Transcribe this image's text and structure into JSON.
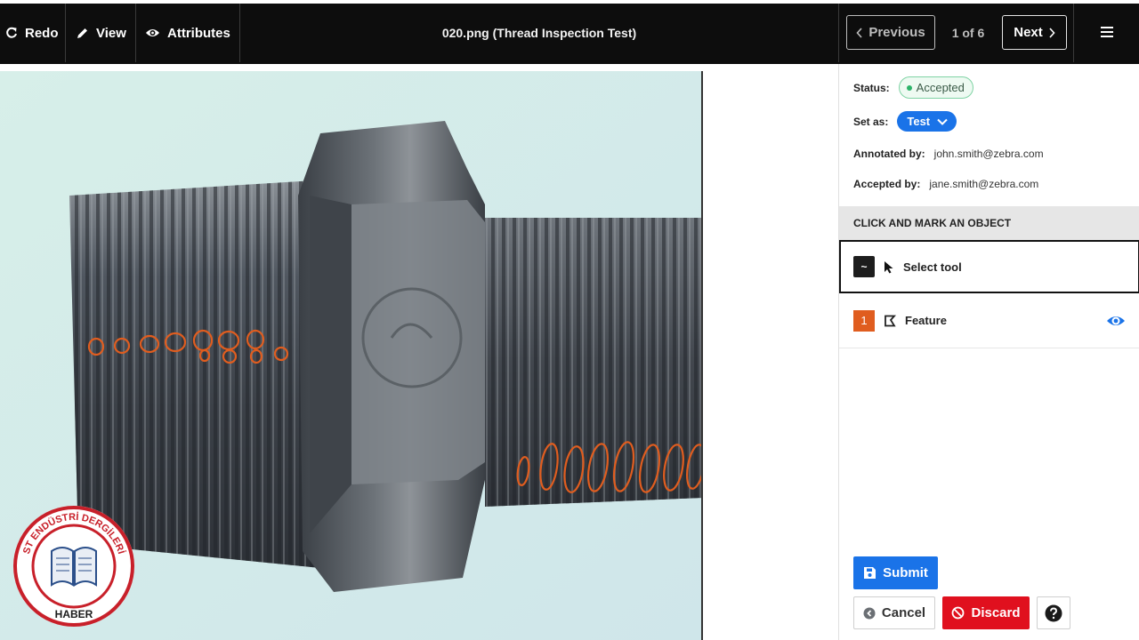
{
  "toolbar": {
    "redo_label": "Redo",
    "view_label": "View",
    "attributes_label": "Attributes",
    "title": "020.png (Thread Inspection Test)",
    "previous_label": "Previous",
    "counter": "1 of 6",
    "next_label": "Next",
    "icons": {
      "redo": "redo-icon",
      "view": "pencil-icon",
      "attributes": "eye-icon",
      "menu": "hamburger-icon"
    }
  },
  "watermark": {
    "top_text": "ST ENDÜSTRİ DERGİLERİ",
    "bottom_text": "HABER"
  },
  "panel": {
    "status_label": "Status:",
    "status_value": "Accepted",
    "set_as_label": "Set as:",
    "set_as_value": "Test",
    "annotated_by_label": "Annotated by:",
    "annotated_by_value": "john.smith@zebra.com",
    "accepted_by_label": "Accepted by:",
    "accepted_by_value": "jane.smith@zebra.com",
    "section_header": "CLICK AND MARK AN OBJECT",
    "tool": {
      "shortcut": "~",
      "label": "Select tool"
    },
    "features": [
      {
        "number": "1",
        "label": "Feature",
        "visible": true
      }
    ]
  },
  "actions": {
    "submit_label": "Submit",
    "cancel_label": "Cancel",
    "discard_label": "Discard"
  },
  "colors": {
    "accent": "#1a73e8",
    "danger": "#e0101e",
    "annotation": "#e05d1f",
    "status_green": "#2db36a",
    "topbar": "#0d0d0d"
  }
}
